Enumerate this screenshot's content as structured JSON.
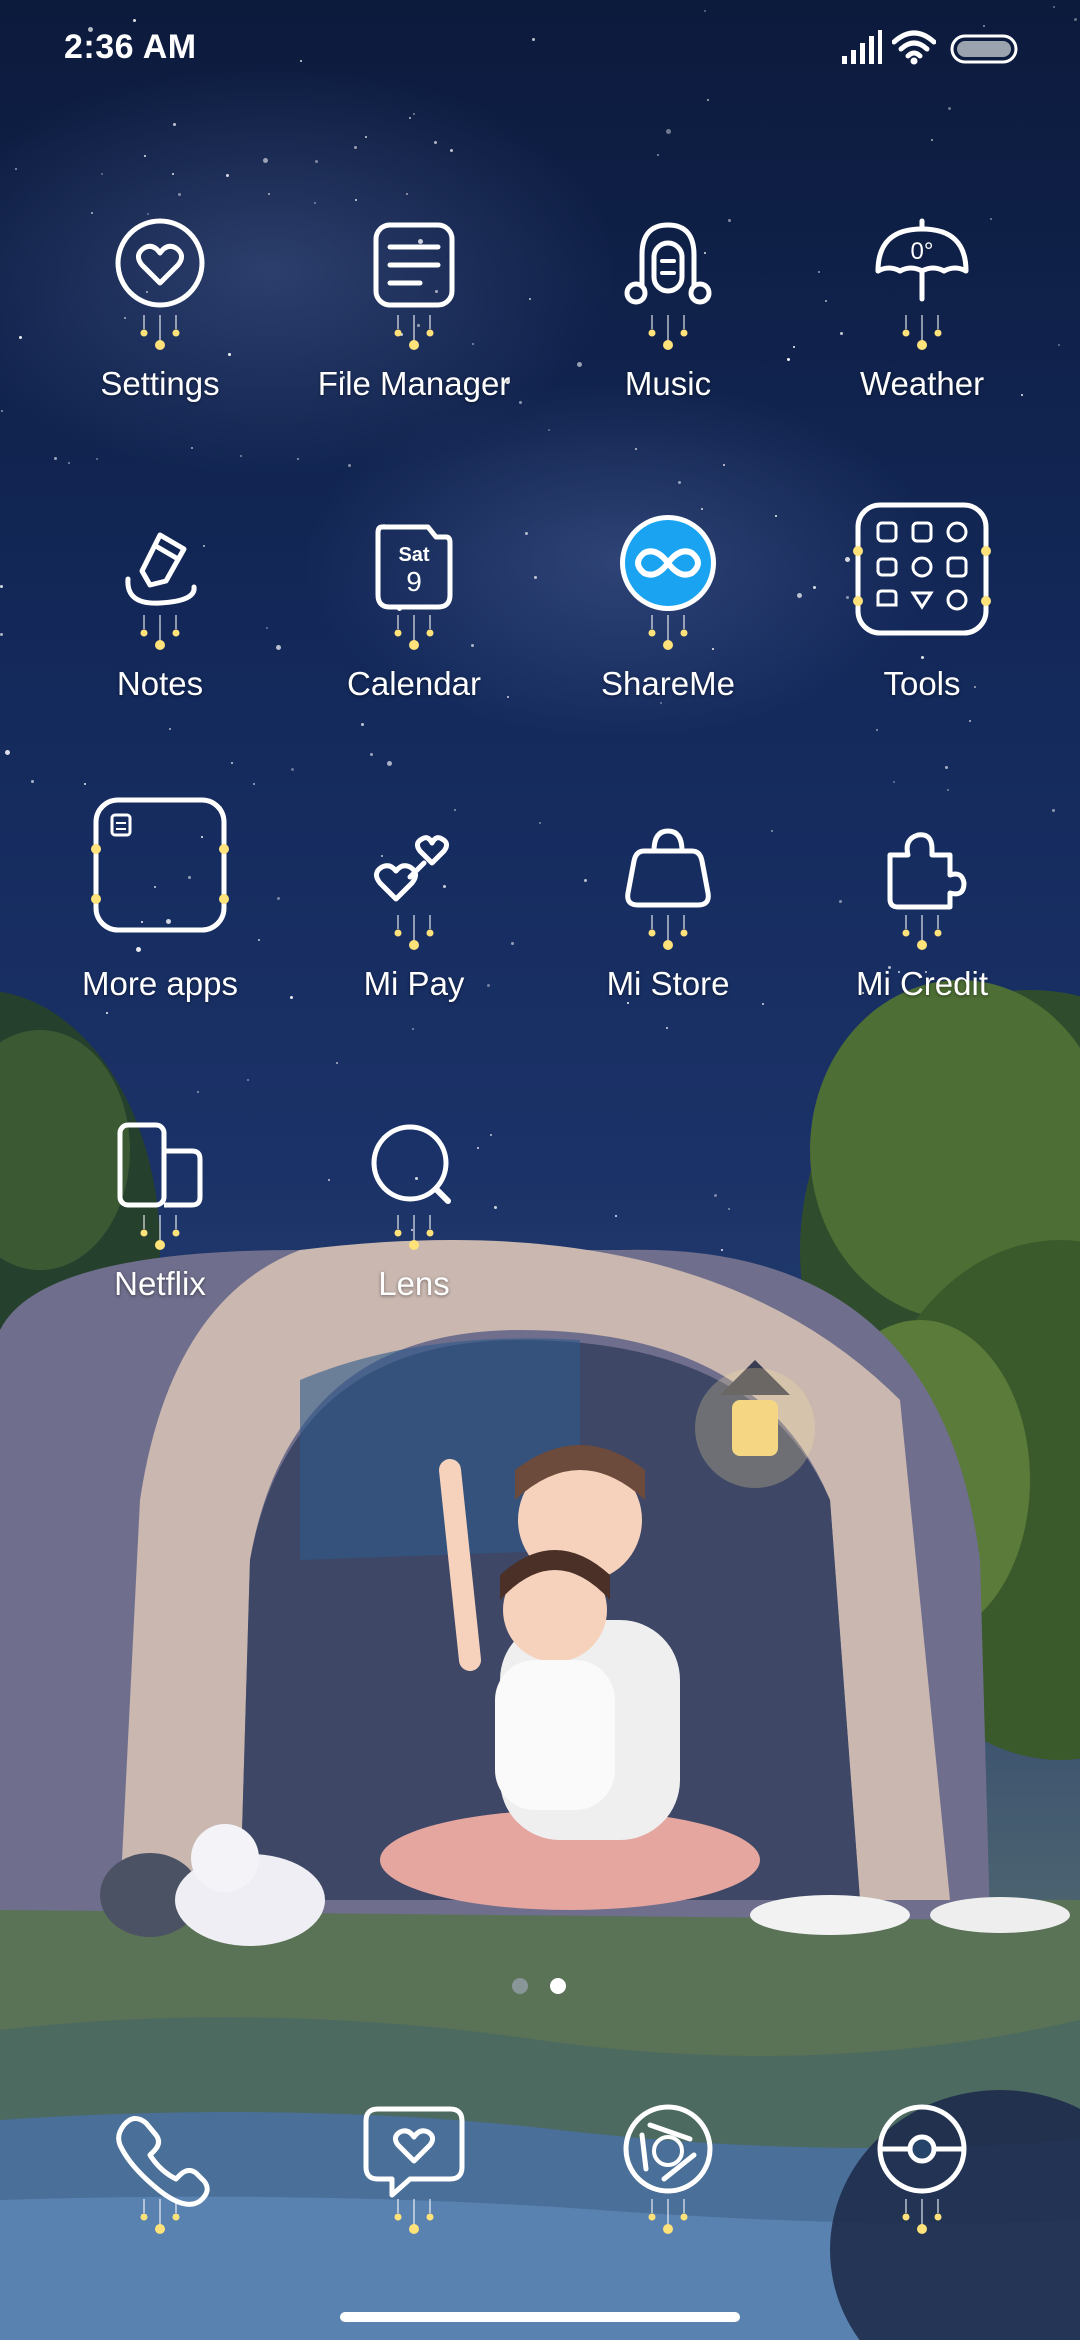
{
  "status_bar": {
    "time": "2:36 AM",
    "icons": [
      "signal-icon",
      "wifi-icon",
      "battery-icon"
    ]
  },
  "apps": [
    {
      "label": "Settings",
      "icon": "heart-circle-icon"
    },
    {
      "label": "File Manager",
      "icon": "folder-list-icon"
    },
    {
      "label": "Music",
      "icon": "headphones-icon"
    },
    {
      "label": "Weather",
      "icon": "umbrella-icon",
      "badge": "0°"
    },
    {
      "label": "Notes",
      "icon": "pen-icon"
    },
    {
      "label": "Calendar",
      "icon": "calendar-icon",
      "day": "Sat",
      "date": "9"
    },
    {
      "label": "ShareMe",
      "icon": "infinity-icon"
    },
    {
      "label": "Tools",
      "icon": "tools-folder-icon"
    },
    {
      "label": "More apps",
      "icon": "folder-icon"
    },
    {
      "label": "Mi Pay",
      "icon": "two-hearts-icon"
    },
    {
      "label": "Mi Store",
      "icon": "bag-icon"
    },
    {
      "label": "Mi Credit",
      "icon": "puzzle-icon"
    },
    {
      "label": "Netflix",
      "icon": "netflix-icon"
    },
    {
      "label": "Lens",
      "icon": "lens-icon"
    }
  ],
  "pager": {
    "pages": 2,
    "active": 2
  },
  "dock": [
    {
      "icon": "phone-icon"
    },
    {
      "icon": "message-heart-icon"
    },
    {
      "icon": "browser-aperture-icon"
    },
    {
      "icon": "camera-icon"
    }
  ],
  "colors": {
    "icon_stroke": "#ffffff",
    "sparkle": "#ffe27a",
    "shareme_blue": "#1aa3f0",
    "dot_inactive": "#9aa3ae",
    "dot_active": "#ffffff"
  }
}
